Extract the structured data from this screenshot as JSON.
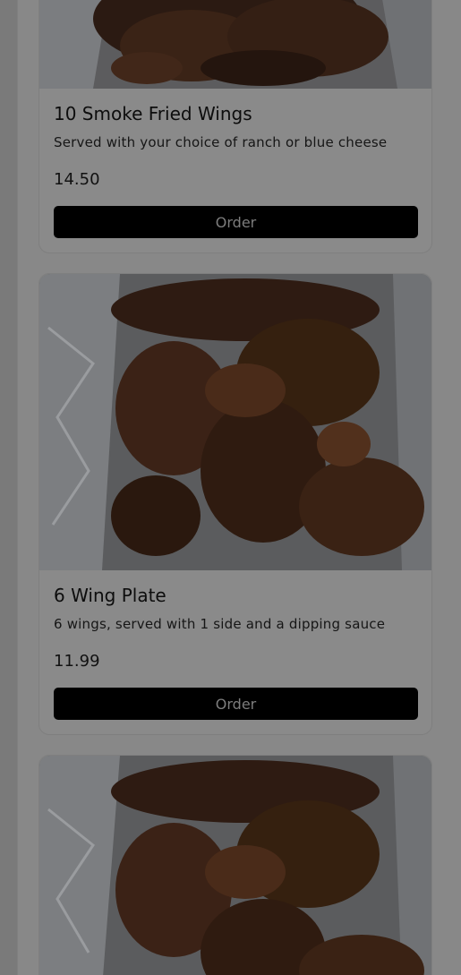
{
  "menu": {
    "items": [
      {
        "title": "10 Smoke Fried Wings",
        "description": "Served with your choice of ranch or blue cheese",
        "price": "14.50",
        "button_label": "Order"
      },
      {
        "title": "6 Wing Plate",
        "description": "6 wings, served with 1 side and a dipping sauce",
        "price": "11.99",
        "button_label": "Order"
      }
    ]
  },
  "colors": {
    "overlay": "#7a7a7a",
    "button": "#000000",
    "button_text": "#7d7d7d"
  }
}
